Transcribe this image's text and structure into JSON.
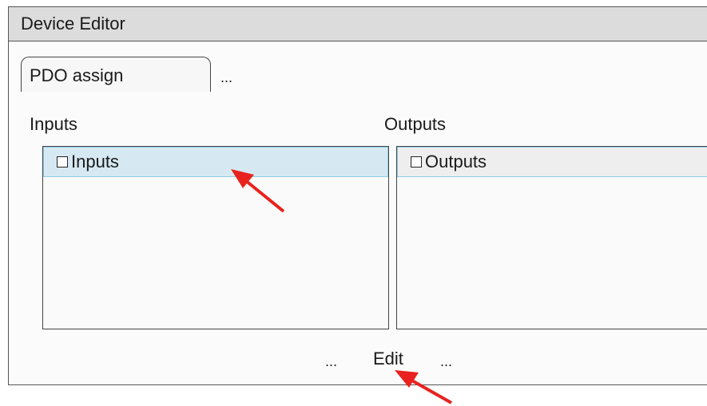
{
  "window": {
    "title": "Device Editor"
  },
  "tabs": {
    "active_label": "PDO assign",
    "more_label": "..."
  },
  "inputs": {
    "section_label": "Inputs",
    "header_label": "Inputs",
    "selected": true
  },
  "outputs": {
    "section_label": "Outputs",
    "header_label": "Outputs",
    "selected": false
  },
  "footer": {
    "left_ellipsis": "...",
    "edit_label": "Edit",
    "right_ellipsis": "..."
  },
  "colors": {
    "selection": "#d6e9f3",
    "selection_border": "#8ecbe3",
    "annotation_arrow": "#e8231f",
    "titlebar": "#dcdcdc"
  }
}
